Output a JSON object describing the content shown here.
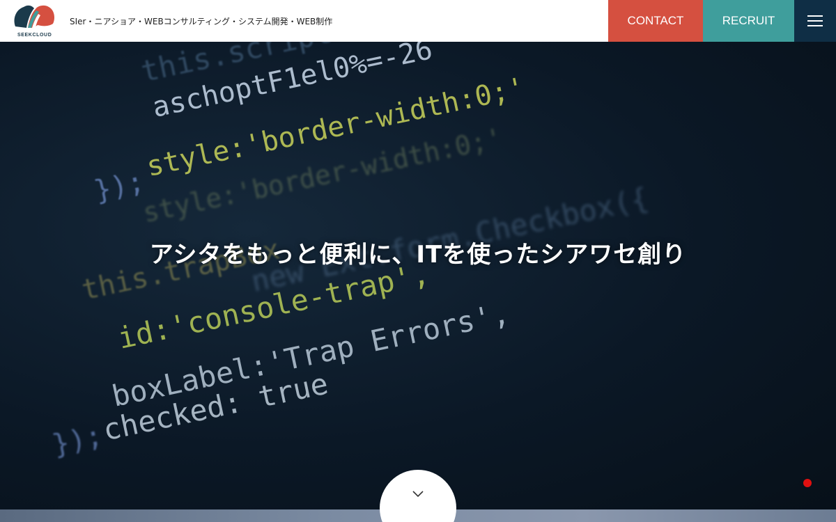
{
  "header": {
    "logo_text": "SEEKCLOUD",
    "tagline": "SIer・ニアショア・WEBコンサルティング・システム開発・WEB制作",
    "contact_label": "CONTACT",
    "recruit_label": "RECRUIT",
    "menu_icon": "hamburger-menu-icon"
  },
  "hero": {
    "title": "アシタをもっと便利に、ITを使ったシアワセ創り",
    "background_code": [
      "this.script",
      "aschoptF1el0%=-26",
      "style:'border-width:0;'",
      "style:'border-width:0;'",
      "});",
      "new Ext.form.Checkbox({",
      "this.trapBox",
      "id:'console-trap',",
      "boxLabel:'Trap Errors',",
      "checked: true",
      "});"
    ],
    "scroll_icon": "chevron-down-icon"
  },
  "colors": {
    "contact": "#d55040",
    "recruit": "#3f9e9c",
    "menu": "#0f2e45",
    "accent_dot": "#e01010"
  }
}
